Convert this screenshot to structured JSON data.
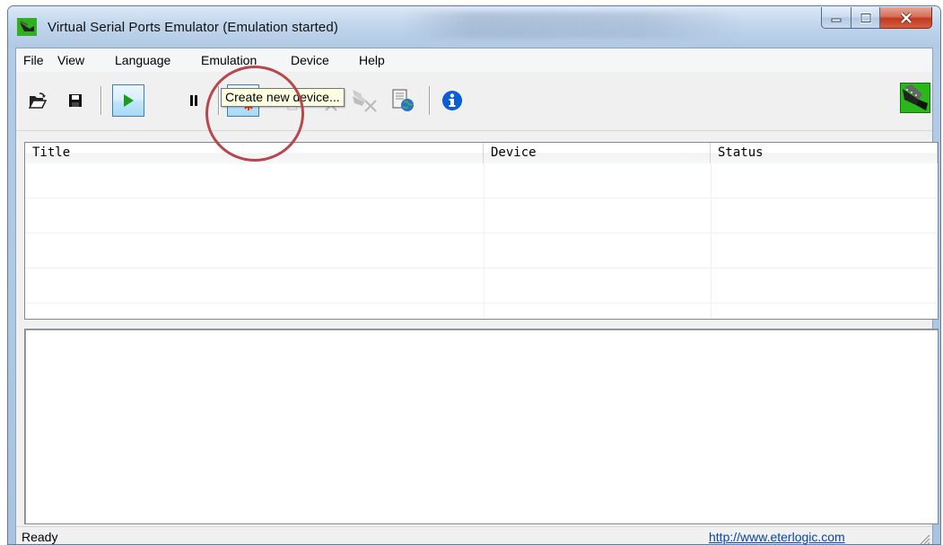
{
  "window": {
    "title": "Virtual Serial Ports Emulator (Emulation started)"
  },
  "menu": {
    "items": [
      {
        "label": "File"
      },
      {
        "label": "View"
      },
      {
        "label": "Language"
      },
      {
        "label": "Emulation"
      },
      {
        "label": "Device"
      },
      {
        "label": "Help"
      }
    ]
  },
  "toolbar": {
    "buttons": [
      {
        "name": "open",
        "icon": "folder-open-icon"
      },
      {
        "name": "save",
        "icon": "floppy-disk-icon"
      },
      {
        "name": "start",
        "icon": "play-icon",
        "state": "pressed"
      },
      {
        "name": "stop",
        "icon": "pause-icon"
      },
      {
        "name": "create-device",
        "icon": "device-new-icon",
        "state": "hover"
      },
      {
        "name": "edit-device",
        "icon": "device-edit-icon",
        "state": "disabled"
      },
      {
        "name": "delete-device",
        "icon": "device-delete-icon",
        "state": "disabled"
      },
      {
        "name": "delete-all-devices",
        "icon": "device-delete-all-icon",
        "state": "disabled"
      },
      {
        "name": "network",
        "icon": "network-globe-icon"
      },
      {
        "name": "about",
        "icon": "info-icon"
      }
    ],
    "tooltip": "Create new device..."
  },
  "devices_table": {
    "columns": [
      "Title",
      "Device",
      "Status"
    ],
    "rows": []
  },
  "statusbar": {
    "text": "Ready",
    "link": "http://www.eterlogic.com"
  },
  "colors": {
    "play": "#1a9b1a",
    "info": "#0b5dd6",
    "highlight_ring": "#b5484d",
    "logo_green": "#29b819",
    "link": "#0645ad"
  }
}
